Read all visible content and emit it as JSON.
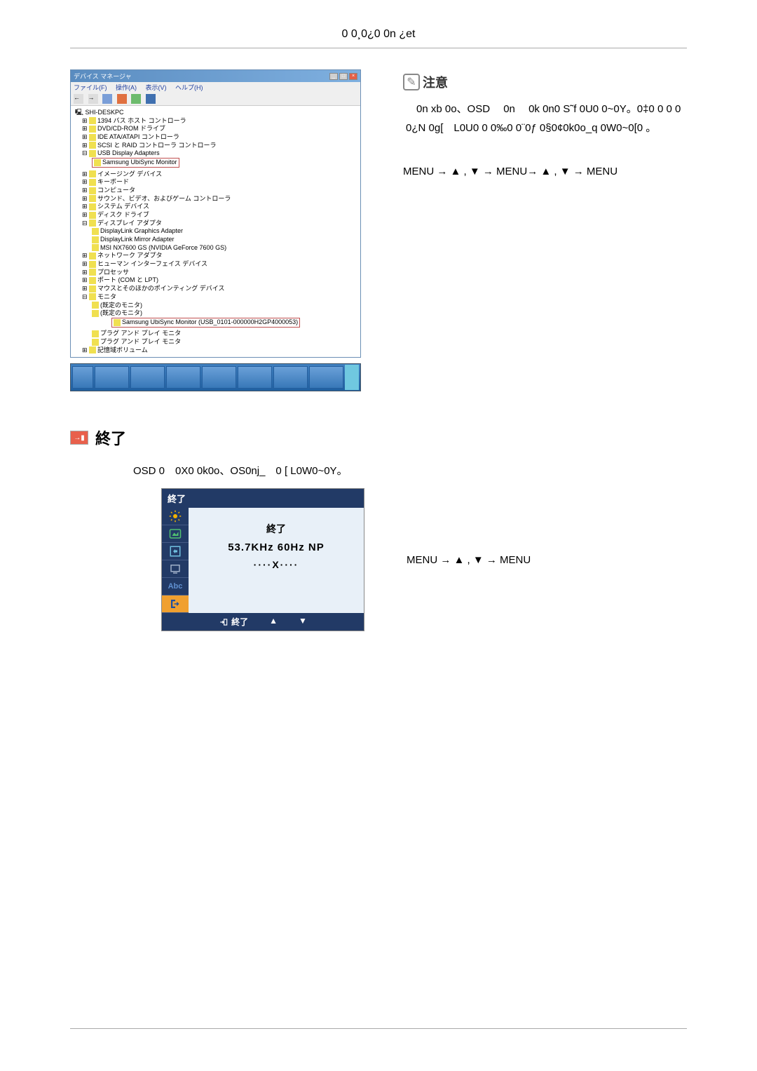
{
  "header": "0 0¸0¿0 0n ¿et",
  "deviceManager": {
    "title": "デバイス マネージャ",
    "menu": {
      "file": "ファイル(F)",
      "action": "操作(A)",
      "view": "表示(V)",
      "help": "ヘルプ(H)"
    },
    "root": "SHI-DESKPC",
    "items": [
      "1394 バス ホスト コントローラ",
      "DVD/CD-ROM ドライブ",
      "IDE ATA/ATAPI コントローラ",
      "SCSI と RAID コントローラ コントローラ",
      "USB Display Adapters",
      "Samsung UbiSync Monitor",
      "イメージング デバイス",
      "キーボード",
      "コンピュータ",
      "サウンド、ビデオ、およびゲーム コントローラ",
      "システム デバイス",
      "ディスク ドライブ",
      "ディスプレイ アダプタ",
      "DisplayLink Graphics Adapter",
      "DisplayLink Mirror Adapter",
      "MSI NX7600 GS (NVIDIA GeForce 7600 GS)",
      "ネットワーク アダプタ",
      "ヒューマン インターフェイス デバイス",
      "プロセッサ",
      "ポート (COM と LPT)",
      "マウスとそのほかのポインティング デバイス",
      "モニタ",
      "(既定のモニタ)",
      "(既定のモニタ)",
      "Samsung UbiSync Monitor (USB_0101-000000H2GP4000053)",
      "プラグ アンド プレイ モニタ",
      "プラグ アンド プレイ モニタ",
      "記憶域ボリューム"
    ]
  },
  "notice": {
    "title": "注意",
    "body": "　0n xb 0o、OSD 　0n 　0k 0n0 S˜f 0U0 0~0Y。0‡0 0 0 0 0¿N 0g[　L0U0 0 0‰0 0¨0ƒ 0§0¢0k0o_q 0W0~0[0 。",
    "nav": "MENU → ▲ , ▼ → MENU→ ▲ , ▼ → MENU"
  },
  "section2": {
    "heading": "終了",
    "desc": "OSD 0　0X0 0k0o、OS0nj_　0 [ L0W0~0Y。",
    "osd": {
      "title": "終了",
      "main_label": "終了",
      "freq": "53.7KHz 60Hz NP",
      "dots": "····X····",
      "footer_label": "終了"
    },
    "nav": "MENU → ▲ , ▼ → MENU"
  }
}
